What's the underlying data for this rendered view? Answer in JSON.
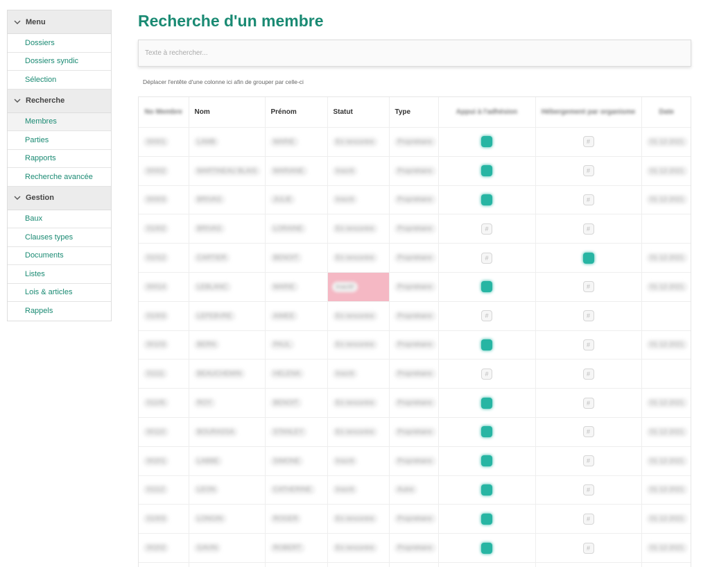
{
  "sidebar": {
    "sections": [
      {
        "title": "Menu",
        "items": [
          "Dossiers",
          "Dossiers syndic",
          "Sélection"
        ]
      },
      {
        "title": "Recherche",
        "items": [
          "Membres",
          "Parties",
          "Rapports",
          "Recherche avancée"
        ]
      },
      {
        "title": "Gestion",
        "items": [
          "Baux",
          "Clauses types",
          "Documents",
          "Listes",
          "Lois & articles",
          "Rappels"
        ]
      }
    ],
    "active_item": "Membres"
  },
  "page": {
    "title": "Recherche d'un membre",
    "search_placeholder": "Texte à rechercher...",
    "group_hint": "Déplacer l'entête d'une colonne ici afin de grouper par celle-ci"
  },
  "grid": {
    "columns": [
      {
        "key": "id",
        "label": "No Membre",
        "blurred": true
      },
      {
        "key": "nom",
        "label": "Nom",
        "blurred": false
      },
      {
        "key": "prenom",
        "label": "Prénom",
        "blurred": false
      },
      {
        "key": "statut",
        "label": "Statut",
        "blurred": false
      },
      {
        "key": "type",
        "label": "Type",
        "blurred": false
      },
      {
        "key": "a",
        "label": "Appui à l'adhésion",
        "blurred": true
      },
      {
        "key": "b",
        "label": "Hébergement par organisme",
        "blurred": true
      },
      {
        "key": "date",
        "label": "Date",
        "blurred": true
      }
    ],
    "rows": [
      {
        "id": "00001",
        "nom": "LAMB",
        "prenom": "MARIE",
        "statut": "En rencontre",
        "type": "Propriétaire",
        "a": true,
        "b": false,
        "date": "01-12-2021"
      },
      {
        "id": "00002",
        "nom": "MARTINEAU BLAIS",
        "prenom": "MARIANE",
        "statut": "Inscrit",
        "type": "Propriétaire",
        "a": true,
        "b": false,
        "date": "01-12-2021"
      },
      {
        "id": "00003",
        "nom": "BRIVAS",
        "prenom": "JULIE",
        "statut": "Inscrit",
        "type": "Propriétaire",
        "a": true,
        "b": false,
        "date": "01-12-2021"
      },
      {
        "id": "01002",
        "nom": "BRIVAS",
        "prenom": "LORAINE",
        "statut": "En rencontre",
        "type": "Propriétaire",
        "a": false,
        "b": false,
        "date": ""
      },
      {
        "id": "01012",
        "nom": "CARTIER",
        "prenom": "BENOIT",
        "statut": "En rencontre",
        "type": "Propriétaire",
        "a": false,
        "b": true,
        "date": "01-12-2021"
      },
      {
        "id": "00014",
        "nom": "LEBLANC",
        "prenom": "MARIE",
        "statut": "Inactif",
        "type": "Propriétaire",
        "a": true,
        "b": false,
        "date": "01-12-2021",
        "flag": true
      },
      {
        "id": "01003",
        "nom": "LEFEBVRE",
        "prenom": "AIMEE",
        "statut": "En rencontre",
        "type": "Propriétaire",
        "a": false,
        "b": false,
        "date": ""
      },
      {
        "id": "00103",
        "nom": "BERN",
        "prenom": "PAUL",
        "statut": "En rencontre",
        "type": "Propriétaire",
        "a": true,
        "b": false,
        "date": "01-12-2021"
      },
      {
        "id": "01111",
        "nom": "BEAUCHEMIN",
        "prenom": "HELENA",
        "statut": "Inscrit",
        "type": "Propriétaire",
        "a": false,
        "b": false,
        "date": ""
      },
      {
        "id": "01105",
        "nom": "ROY",
        "prenom": "BENOIT",
        "statut": "En rencontre",
        "type": "Propriétaire",
        "a": true,
        "b": false,
        "date": "01-12-2021"
      },
      {
        "id": "00110",
        "nom": "BOURASSA",
        "prenom": "STANLEY",
        "statut": "En rencontre",
        "type": "Propriétaire",
        "a": true,
        "b": false,
        "date": "01-12-2021"
      },
      {
        "id": "00201",
        "nom": "LABBE",
        "prenom": "SIMONE",
        "statut": "Inscrit",
        "type": "Propriétaire",
        "a": true,
        "b": false,
        "date": "01-12-2021"
      },
      {
        "id": "01112",
        "nom": "LEON",
        "prenom": "CATHERINE",
        "statut": "Inscrit",
        "type": "Autre",
        "a": true,
        "b": false,
        "date": "01-12-2021"
      },
      {
        "id": "01003",
        "nom": "LONGIN",
        "prenom": "ROGER",
        "statut": "En rencontre",
        "type": "Propriétaire",
        "a": true,
        "b": false,
        "date": "01-12-2021"
      },
      {
        "id": "00202",
        "nom": "GAVIN",
        "prenom": "ROBERT",
        "statut": "En rencontre",
        "type": "Propriétaire",
        "a": true,
        "b": false,
        "date": "01-12-2021"
      },
      {
        "id": "",
        "nom": "",
        "prenom": "",
        "statut": "",
        "type": "",
        "a": null,
        "b": null,
        "date": ""
      }
    ]
  },
  "colors": {
    "accent": "#1a8a73",
    "checkbox_on": "#27b5a3",
    "status_flag": "#f5b8c4"
  }
}
